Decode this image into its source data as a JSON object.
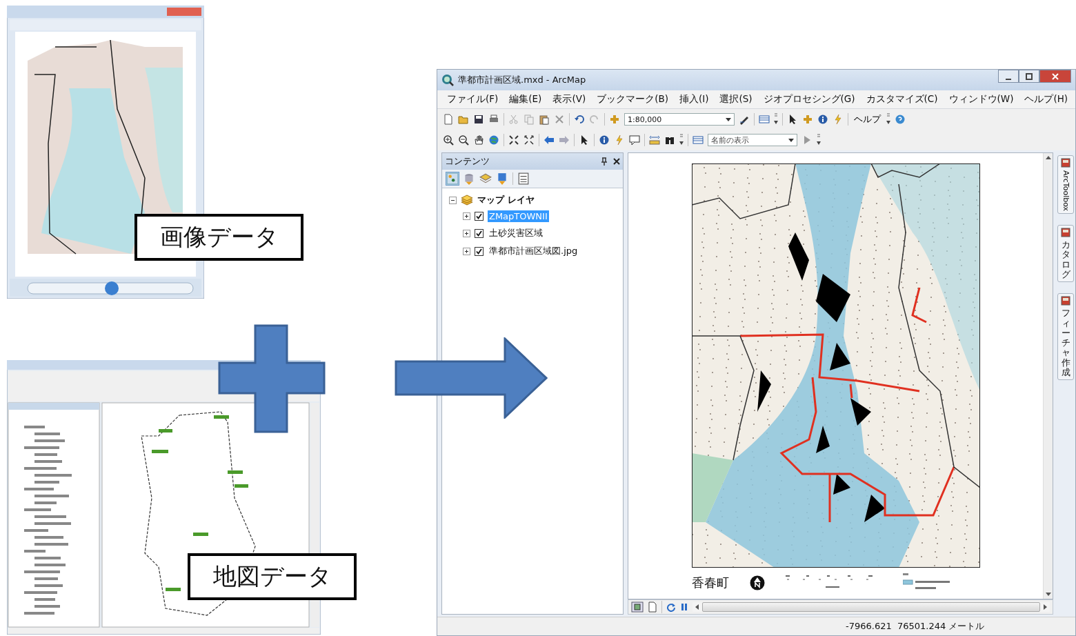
{
  "captions": [
    {
      "text": "画像データ"
    },
    {
      "text": "地図データ"
    }
  ],
  "arcmap": {
    "title": "準都市計画区域.mxd - ArcMap",
    "menu": [
      "ファイル(F)",
      "編集(E)",
      "表示(V)",
      "ブックマーク(B)",
      "挿入(I)",
      "選択(S)",
      "ジオプロセシング(G)",
      "カスタマイズ(C)",
      "ウィンドウ(W)",
      "ヘルプ(H)"
    ],
    "scale": "1:80,000",
    "help_label": "ヘルプ",
    "layer_combo": "名前の表示",
    "contents": {
      "title": "コンテンツ",
      "root": {
        "name": "マップ レイヤ",
        "expanded": true
      },
      "layers": [
        {
          "name": "ZMapTOWNII",
          "checked": true,
          "selected": true
        },
        {
          "name": "土砂災害区域",
          "checked": true,
          "selected": false
        },
        {
          "name": "準都市計画区域図.jpg",
          "checked": true,
          "selected": false
        }
      ]
    },
    "map": {
      "place_name": "香春町"
    },
    "side_tabs": [
      {
        "label": "ArcToolbox",
        "kind": "latin"
      },
      {
        "label": "カタログ",
        "kind": "cjk"
      },
      {
        "label": "フィーチャ作成",
        "kind": "cjk"
      }
    ],
    "status": "-7966.621  76501.244 メートル"
  }
}
